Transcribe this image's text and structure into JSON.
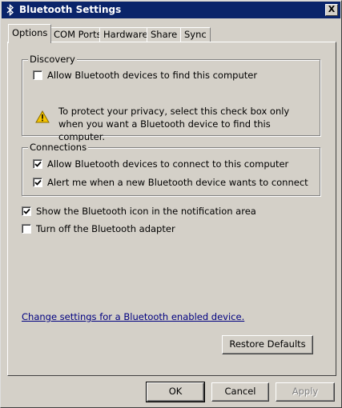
{
  "window": {
    "title": "Bluetooth Settings",
    "close_label": "X"
  },
  "tabs": [
    {
      "label": "Options",
      "active": true
    },
    {
      "label": "COM Ports",
      "active": false
    },
    {
      "label": "Hardware",
      "active": false
    },
    {
      "label": "Share",
      "active": false
    },
    {
      "label": "Sync",
      "active": false
    }
  ],
  "discovery": {
    "legend": "Discovery",
    "allow_find": {
      "label": "Allow Bluetooth devices to find this computer",
      "checked": false
    },
    "warning_text": "To protect your privacy, select this check box only when you want a Bluetooth device to find this computer."
  },
  "connections": {
    "legend": "Connections",
    "allow_connect": {
      "label": "Allow Bluetooth devices to connect to this computer",
      "checked": true
    },
    "alert_new": {
      "label": "Alert me when a new Bluetooth device wants to connect",
      "checked": true
    }
  },
  "options": {
    "show_icon": {
      "label": "Show the Bluetooth icon in the notification area",
      "checked": true
    },
    "turn_off": {
      "label": "Turn off the Bluetooth adapter",
      "checked": false
    }
  },
  "link_text": "Change settings for a Bluetooth enabled device.",
  "buttons": {
    "restore_defaults": "Restore Defaults",
    "ok": "OK",
    "cancel": "Cancel",
    "apply": "Apply"
  },
  "icons": {
    "title_icon": "bluetooth-icon",
    "warning_icon": "warning-icon",
    "check_icon": "checkmark-icon"
  },
  "colors": {
    "titlebar": "#0a246a",
    "face": "#d4d0c8",
    "link": "#000080",
    "warning": "#f5c400"
  }
}
